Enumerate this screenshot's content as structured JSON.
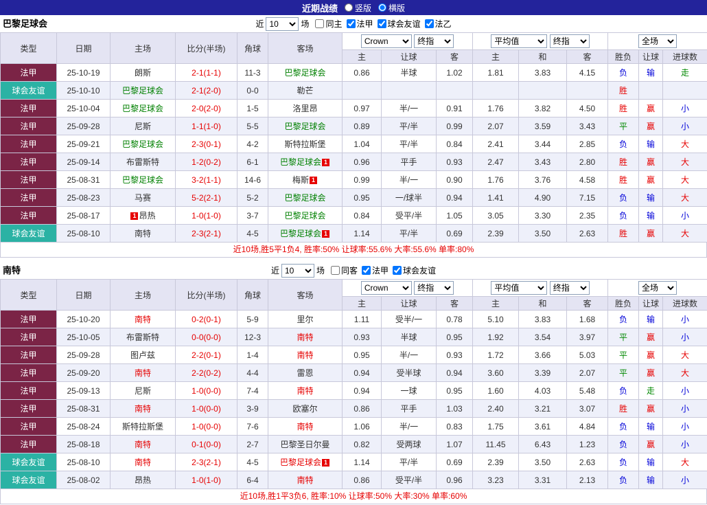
{
  "navbar": {
    "title": "近期战绩",
    "layout_options": [
      {
        "label": "竖版",
        "checked": false
      },
      {
        "label": "横版",
        "checked": true
      }
    ]
  },
  "headers": {
    "type": "类型",
    "date": "日期",
    "home": "主场",
    "score": "比分(半场)",
    "corner": "角球",
    "away": "客场",
    "odds_home": "主",
    "odds_handicap": "让球",
    "odds_away": "客",
    "avg_home": "主",
    "avg_draw": "和",
    "avg_away": "客",
    "result_wl": "胜负",
    "result_handicap": "让球",
    "result_goals": "进球数"
  },
  "sections": [
    {
      "team": "巴黎足球会",
      "filters": {
        "prefix": "近",
        "count": "10",
        "suffix": "场",
        "checkboxes": [
          {
            "label": "同主",
            "checked": false
          },
          {
            "label": "法甲",
            "checked": true
          },
          {
            "label": "球会友谊",
            "checked": true
          },
          {
            "label": "法乙",
            "checked": true
          }
        ]
      },
      "controls": {
        "company": "Crown",
        "company_stage": "终指",
        "average": "平均值",
        "average_stage": "终指",
        "scope": "全场"
      },
      "rows": [
        {
          "type": "法甲",
          "date": "25-10-19",
          "home": {
            "name": "朗斯"
          },
          "score": "2-1(1-1)",
          "corner": "11-3",
          "away": {
            "name": "巴黎足球会",
            "color": "green"
          },
          "odds": [
            "0.86",
            "半球",
            "1.02"
          ],
          "avg": [
            "1.81",
            "3.83",
            "4.15"
          ],
          "result": [
            "负",
            "输",
            "走"
          ]
        },
        {
          "type": "球会友谊",
          "date": "25-10-10",
          "home": {
            "name": "巴黎足球会",
            "color": "green"
          },
          "score": "2-1(2-0)",
          "corner": "0-0",
          "away": {
            "name": "勒芒"
          },
          "odds": [
            "",
            "",
            ""
          ],
          "avg": [
            "",
            "",
            ""
          ],
          "result": [
            "胜",
            "",
            ""
          ]
        },
        {
          "type": "法甲",
          "date": "25-10-04",
          "home": {
            "name": "巴黎足球会",
            "color": "green"
          },
          "score": "2-0(2-0)",
          "corner": "1-5",
          "away": {
            "name": "洛里昂"
          },
          "odds": [
            "0.97",
            "半/一",
            "0.91"
          ],
          "avg": [
            "1.76",
            "3.82",
            "4.50"
          ],
          "result": [
            "胜",
            "赢",
            "小"
          ]
        },
        {
          "type": "法甲",
          "date": "25-09-28",
          "home": {
            "name": "尼斯"
          },
          "score": "1-1(1-0)",
          "corner": "5-5",
          "away": {
            "name": "巴黎足球会",
            "color": "green"
          },
          "odds": [
            "0.89",
            "平/半",
            "0.99"
          ],
          "avg": [
            "2.07",
            "3.59",
            "3.43"
          ],
          "result": [
            "平",
            "赢",
            "小"
          ]
        },
        {
          "type": "法甲",
          "date": "25-09-21",
          "home": {
            "name": "巴黎足球会",
            "color": "green"
          },
          "score": "2-3(0-1)",
          "corner": "4-2",
          "away": {
            "name": "斯特拉斯堡"
          },
          "odds": [
            "1.04",
            "平/半",
            "0.84"
          ],
          "avg": [
            "2.41",
            "3.44",
            "2.85"
          ],
          "result": [
            "负",
            "输",
            "大"
          ]
        },
        {
          "type": "法甲",
          "date": "25-09-14",
          "home": {
            "name": "布雷斯特"
          },
          "score": "1-2(0-2)",
          "corner": "6-1",
          "away": {
            "name": "巴黎足球会",
            "color": "green",
            "badge": "1"
          },
          "odds": [
            "0.96",
            "平手",
            "0.93"
          ],
          "avg": [
            "2.47",
            "3.43",
            "2.80"
          ],
          "result": [
            "胜",
            "赢",
            "大"
          ]
        },
        {
          "type": "法甲",
          "date": "25-08-31",
          "home": {
            "name": "巴黎足球会",
            "color": "green"
          },
          "score": "3-2(1-1)",
          "corner": "14-6",
          "away": {
            "name": "梅斯",
            "badge": "1"
          },
          "odds": [
            "0.99",
            "半/一",
            "0.90"
          ],
          "avg": [
            "1.76",
            "3.76",
            "4.58"
          ],
          "result": [
            "胜",
            "赢",
            "大"
          ]
        },
        {
          "type": "法甲",
          "date": "25-08-23",
          "home": {
            "name": "马赛"
          },
          "score": "5-2(2-1)",
          "corner": "5-2",
          "away": {
            "name": "巴黎足球会",
            "color": "green"
          },
          "odds": [
            "0.95",
            "一/球半",
            "0.94"
          ],
          "avg": [
            "1.41",
            "4.90",
            "7.15"
          ],
          "result": [
            "负",
            "输",
            "大"
          ]
        },
        {
          "type": "法甲",
          "date": "25-08-17",
          "home": {
            "name": "昂热",
            "badge": "1",
            "badge_pos": "before"
          },
          "score": "1-0(1-0)",
          "corner": "3-7",
          "away": {
            "name": "巴黎足球会",
            "color": "green"
          },
          "odds": [
            "0.84",
            "受平/半",
            "1.05"
          ],
          "avg": [
            "3.05",
            "3.30",
            "2.35"
          ],
          "result": [
            "负",
            "输",
            "小"
          ]
        },
        {
          "type": "球会友谊",
          "date": "25-08-10",
          "home": {
            "name": "南特"
          },
          "score": "2-3(2-1)",
          "corner": "4-5",
          "away": {
            "name": "巴黎足球会",
            "color": "green",
            "badge": "1"
          },
          "odds": [
            "1.14",
            "平/半",
            "0.69"
          ],
          "avg": [
            "2.39",
            "3.50",
            "2.63"
          ],
          "result": [
            "胜",
            "赢",
            "大"
          ]
        }
      ],
      "summary": "近10场,胜5平1负4, 胜率:50% 让球率:55.6% 大率:55.6% 单率:80%"
    },
    {
      "team": "南特",
      "filters": {
        "prefix": "近",
        "count": "10",
        "suffix": "场",
        "checkboxes": [
          {
            "label": "同客",
            "checked": false
          },
          {
            "label": "法甲",
            "checked": true
          },
          {
            "label": "球会友谊",
            "checked": true
          }
        ]
      },
      "controls": {
        "company": "Crown",
        "company_stage": "终指",
        "average": "平均值",
        "average_stage": "终指",
        "scope": "全场"
      },
      "rows": [
        {
          "type": "法甲",
          "date": "25-10-20",
          "home": {
            "name": "南特",
            "color": "red"
          },
          "score": "0-2(0-1)",
          "corner": "5-9",
          "away": {
            "name": "里尔"
          },
          "odds": [
            "1.11",
            "受半/一",
            "0.78"
          ],
          "avg": [
            "5.10",
            "3.83",
            "1.68"
          ],
          "result": [
            "负",
            "输",
            "小"
          ]
        },
        {
          "type": "法甲",
          "date": "25-10-05",
          "home": {
            "name": "布雷斯特"
          },
          "score": "0-0(0-0)",
          "corner": "12-3",
          "away": {
            "name": "南特",
            "color": "red"
          },
          "odds": [
            "0.93",
            "半球",
            "0.95"
          ],
          "avg": [
            "1.92",
            "3.54",
            "3.97"
          ],
          "result": [
            "平",
            "赢",
            "小"
          ]
        },
        {
          "type": "法甲",
          "date": "25-09-28",
          "home": {
            "name": "图卢兹"
          },
          "score": "2-2(0-1)",
          "corner": "1-4",
          "away": {
            "name": "南特",
            "color": "red"
          },
          "odds": [
            "0.95",
            "半/一",
            "0.93"
          ],
          "avg": [
            "1.72",
            "3.66",
            "5.03"
          ],
          "result": [
            "平",
            "赢",
            "大"
          ]
        },
        {
          "type": "法甲",
          "date": "25-09-20",
          "home": {
            "name": "南特",
            "color": "red"
          },
          "score": "2-2(0-2)",
          "corner": "4-4",
          "away": {
            "name": "雷恩"
          },
          "odds": [
            "0.94",
            "受半球",
            "0.94"
          ],
          "avg": [
            "3.60",
            "3.39",
            "2.07"
          ],
          "result": [
            "平",
            "赢",
            "大"
          ]
        },
        {
          "type": "法甲",
          "date": "25-09-13",
          "home": {
            "name": "尼斯"
          },
          "score": "1-0(0-0)",
          "corner": "7-4",
          "away": {
            "name": "南特",
            "color": "red"
          },
          "odds": [
            "0.94",
            "一球",
            "0.95"
          ],
          "avg": [
            "1.60",
            "4.03",
            "5.48"
          ],
          "result": [
            "负",
            "走",
            "小"
          ]
        },
        {
          "type": "法甲",
          "date": "25-08-31",
          "home": {
            "name": "南特",
            "color": "red"
          },
          "score": "1-0(0-0)",
          "corner": "3-9",
          "away": {
            "name": "欧塞尔"
          },
          "odds": [
            "0.86",
            "平手",
            "1.03"
          ],
          "avg": [
            "2.40",
            "3.21",
            "3.07"
          ],
          "result": [
            "胜",
            "赢",
            "小"
          ]
        },
        {
          "type": "法甲",
          "date": "25-08-24",
          "home": {
            "name": "斯特拉斯堡"
          },
          "score": "1-0(0-0)",
          "corner": "7-6",
          "away": {
            "name": "南特",
            "color": "red"
          },
          "odds": [
            "1.06",
            "半/一",
            "0.83"
          ],
          "avg": [
            "1.75",
            "3.61",
            "4.84"
          ],
          "result": [
            "负",
            "输",
            "小"
          ]
        },
        {
          "type": "法甲",
          "date": "25-08-18",
          "home": {
            "name": "南特",
            "color": "red"
          },
          "score": "0-1(0-0)",
          "corner": "2-7",
          "away": {
            "name": "巴黎圣日尔曼"
          },
          "odds": [
            "0.82",
            "受两球",
            "1.07"
          ],
          "avg": [
            "11.45",
            "6.43",
            "1.23"
          ],
          "result": [
            "负",
            "赢",
            "小"
          ]
        },
        {
          "type": "球会友谊",
          "date": "25-08-10",
          "home": {
            "name": "南特",
            "color": "red"
          },
          "score": "2-3(2-1)",
          "corner": "4-5",
          "away": {
            "name": "巴黎足球会",
            "color": "red",
            "badge": "1"
          },
          "odds": [
            "1.14",
            "平/半",
            "0.69"
          ],
          "avg": [
            "2.39",
            "3.50",
            "2.63"
          ],
          "result": [
            "负",
            "输",
            "大"
          ]
        },
        {
          "type": "球会友谊",
          "date": "25-08-02",
          "home": {
            "name": "昂热"
          },
          "score": "1-0(1-0)",
          "corner": "6-4",
          "away": {
            "name": "南特",
            "color": "red"
          },
          "odds": [
            "0.86",
            "受平/半",
            "0.96"
          ],
          "avg": [
            "3.23",
            "3.31",
            "2.13"
          ],
          "result": [
            "负",
            "输",
            "小"
          ]
        }
      ],
      "summary": "近10场,胜1平3负6, 胜率:10% 让球率:50% 大率:30% 单率:60%"
    }
  ]
}
